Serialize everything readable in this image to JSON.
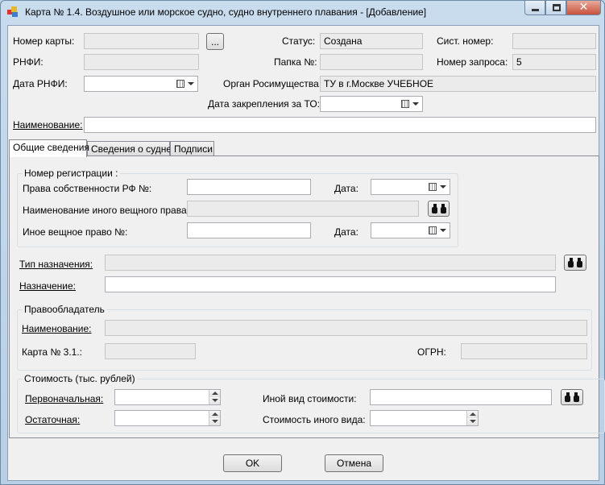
{
  "window": {
    "title": "Карта  № 1.4. Воздушное или морское судно, судно внутреннего плавания - [Добавление]",
    "close_glyph": "✕"
  },
  "header": {
    "card_number_label": "Номер карты:",
    "card_number_value": "",
    "browse_label": "...",
    "status_label": "Статус:",
    "status_value": "Создана",
    "sys_number_label": "Сист. номер:",
    "sys_number_value": "",
    "rnfi_label": "РНФИ:",
    "rnfi_value": "",
    "folder_label": "Папка №:",
    "folder_value": "",
    "request_number_label": "Номер запроса:",
    "request_number_value": "5",
    "rnfi_date_label": "Дата РНФИ:",
    "authority_label": "Орган Росимущества:",
    "authority_value": "ТУ в г.Москве УЧЕБНОЕ",
    "assign_date_label": "Дата закрепления за ТО:",
    "name_label": "Наименование:",
    "name_value": ""
  },
  "tabs": [
    {
      "label": "Общие сведения"
    },
    {
      "label": "Сведения о судне"
    },
    {
      "label": "Подписи"
    }
  ],
  "registration": {
    "group_title": "Номер регистрации :",
    "ownership_label": "Права собственности РФ №:",
    "date_label": "Дата:",
    "other_right_name_label": "Наименование иного вещного права:",
    "other_right_label": "Иное вещное право  №:",
    "date2_label": "Дата:"
  },
  "purpose": {
    "type_label": "Тип назначения:",
    "purpose_label": "Назначение:"
  },
  "holder": {
    "group_title": "Правообладатель",
    "name_label": "Наименование:",
    "card_label": "Карта № 3.1.:",
    "ogrn_label": "ОГРН:"
  },
  "cost": {
    "group_title": "Стоимость (тыс. рублей)",
    "initial_label": "Первоначальная:",
    "residual_label": "Остаточная:",
    "other_type_label": "Иной вид стоимости:",
    "other_cost_label": "Стоимость иного вида:"
  },
  "footer": {
    "ok_label": "OK",
    "cancel_label": "Отмена"
  }
}
